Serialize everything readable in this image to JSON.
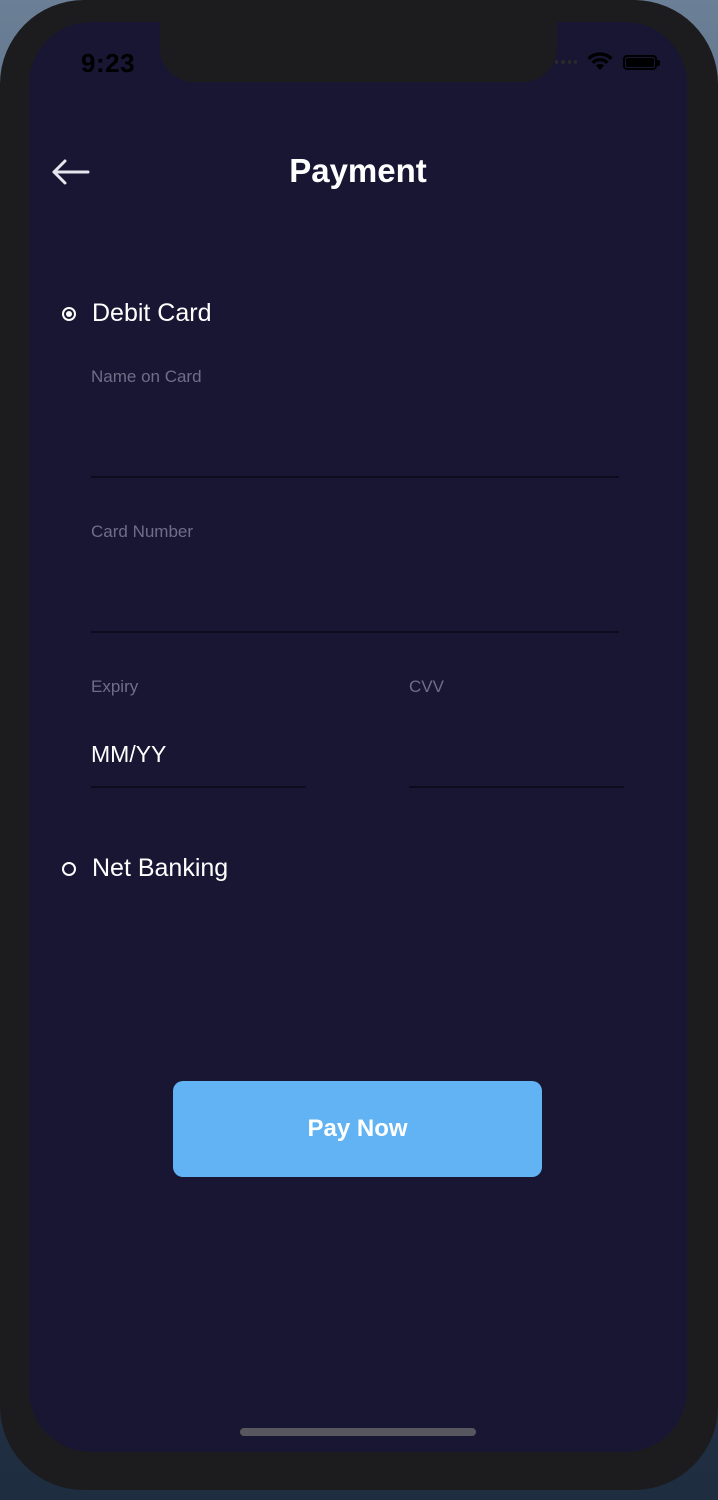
{
  "status_bar": {
    "time": "9:23",
    "icons": [
      "cellular-signal-icon",
      "wifi-icon",
      "battery-icon"
    ]
  },
  "header": {
    "title": "Payment",
    "back_icon": "arrow-left-icon"
  },
  "payment_options": {
    "debit_card": {
      "label": "Debit Card",
      "selected": true,
      "fields": {
        "name_on_card": {
          "label": "Name on Card",
          "value": "",
          "placeholder": ""
        },
        "card_number": {
          "label": "Card Number",
          "value": "",
          "placeholder": ""
        },
        "expiry": {
          "label": "Expiry",
          "value": "",
          "placeholder": "MM/YY"
        },
        "cvv": {
          "label": "CVV",
          "value": "",
          "placeholder": ""
        }
      }
    },
    "net_banking": {
      "label": "Net Banking",
      "selected": false
    }
  },
  "actions": {
    "pay_now_label": "Pay Now"
  },
  "colors": {
    "screen_background": "#181633",
    "button_background": "#62b3f4",
    "label_text": "#6f6e86",
    "primary_text": "#ffffff"
  }
}
